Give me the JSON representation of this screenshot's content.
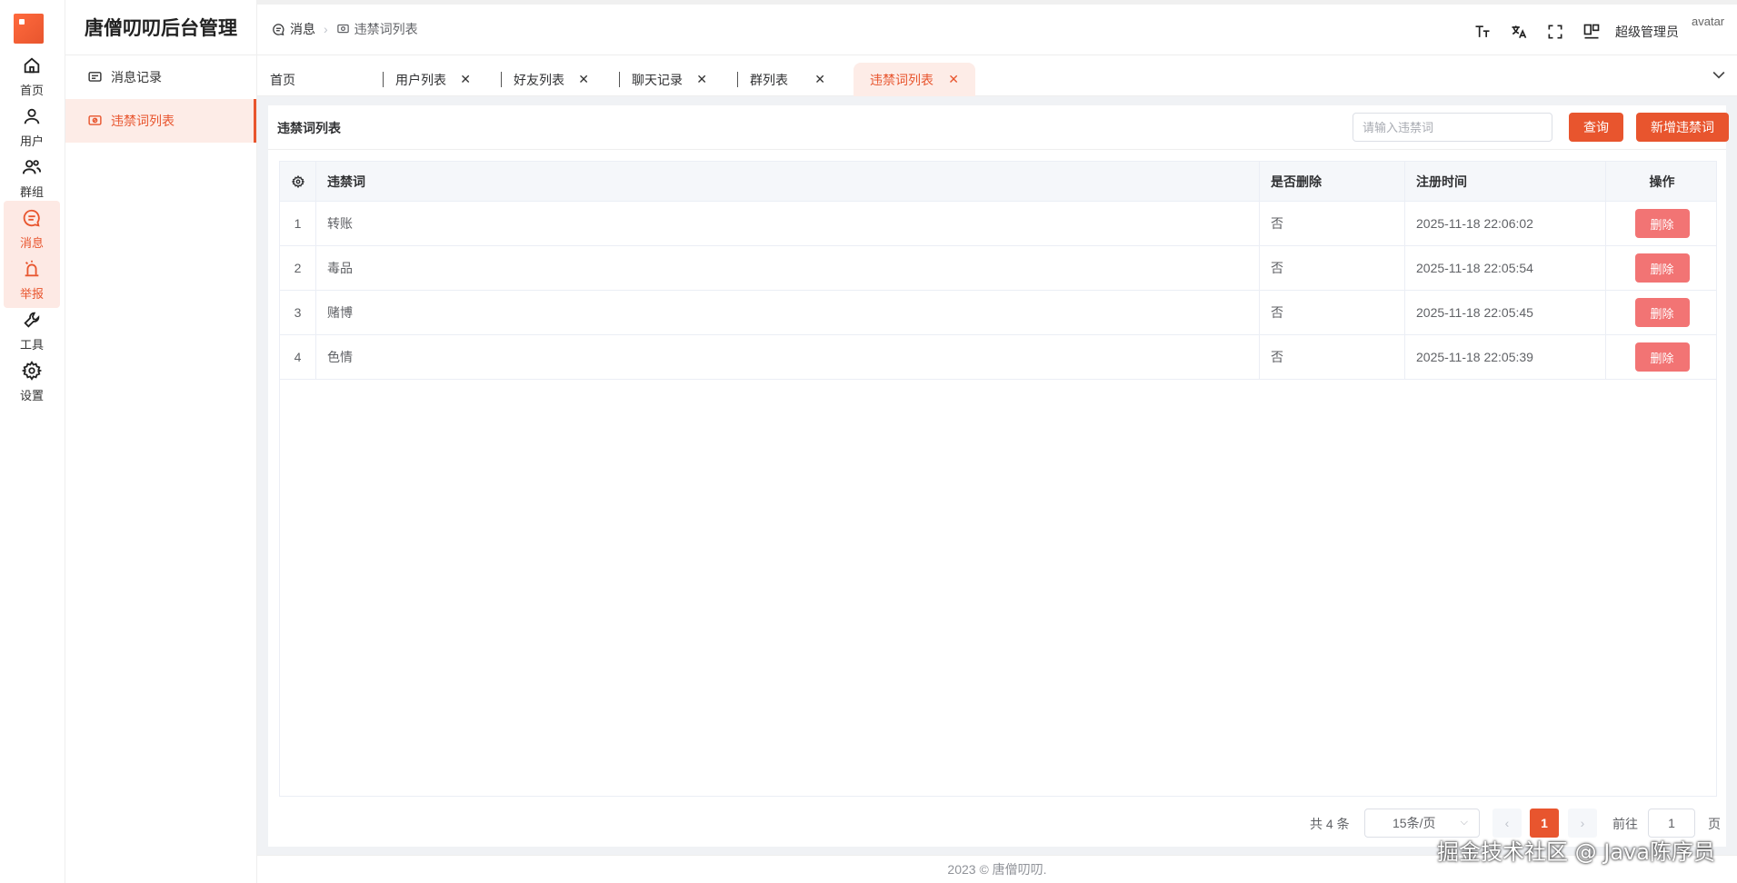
{
  "rail": [
    {
      "label": "首页",
      "icon": "home-icon"
    },
    {
      "label": "用户",
      "icon": "user-icon"
    },
    {
      "label": "群组",
      "icon": "group-icon"
    },
    {
      "label": "消息",
      "icon": "message-icon"
    },
    {
      "label": "举报",
      "icon": "alarm-icon"
    },
    {
      "label": "工具",
      "icon": "wrench-icon"
    },
    {
      "label": "设置",
      "icon": "gear-icon"
    }
  ],
  "app_title": "唐僧叨叨后台管理",
  "subnav": [
    {
      "label": "消息记录",
      "icon": "chat-record-icon"
    },
    {
      "label": "违禁词列表",
      "icon": "banned-words-icon"
    }
  ],
  "breadcrumb": {
    "first": "消息",
    "second": "违禁词列表"
  },
  "header": {
    "user_name": "超级管理员",
    "avatar_alt": "avatar"
  },
  "tags": [
    {
      "label": "首页"
    },
    {
      "label": "用户列表",
      "close": "✕"
    },
    {
      "label": "好友列表",
      "close": "✕"
    },
    {
      "label": "聊天记录",
      "close": "✕"
    },
    {
      "label": "群列表",
      "close": "✕"
    },
    {
      "label": "违禁词列表",
      "close": "✕"
    }
  ],
  "card": {
    "title": "违禁词列表",
    "search_placeholder": "请输入违禁词",
    "query_button": "查询",
    "add_button": "新增违禁词"
  },
  "table": {
    "headers": {
      "word": "违禁词",
      "deleted": "是否删除",
      "created": "注册时间",
      "actions": "操作"
    },
    "rows": [
      {
        "index": "1",
        "word": "转账",
        "deleted": "否",
        "created": "2025-11-18 22:06:02",
        "action": "删除"
      },
      {
        "index": "2",
        "word": "毒品",
        "deleted": "否",
        "created": "2025-11-18 22:05:54",
        "action": "删除"
      },
      {
        "index": "3",
        "word": "赌博",
        "deleted": "否",
        "created": "2025-11-18 22:05:45",
        "action": "删除"
      },
      {
        "index": "4",
        "word": "色情",
        "deleted": "否",
        "created": "2025-11-18 22:05:39",
        "action": "删除"
      }
    ]
  },
  "pagination": {
    "total": "共 4 条",
    "page_size": "15条/页",
    "current_page": "1",
    "goto_label": "前往",
    "goto_value": "1",
    "page_unit": "页"
  },
  "footer": "2023 © 唐僧叨叨.",
  "watermark": "掘金技术社区 @ Java陈序员",
  "colors": {
    "accent": "#e8552e",
    "danger": "#f27474"
  }
}
